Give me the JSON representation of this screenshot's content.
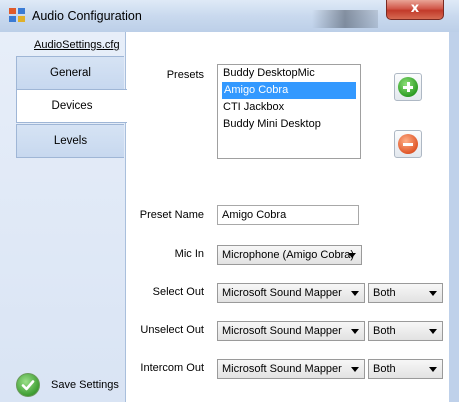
{
  "window": {
    "title": "Audio Configuration",
    "close_glyph": "x"
  },
  "sidebar": {
    "config_link": "AudioSettings.cfg",
    "tabs": [
      {
        "label": "General",
        "active": false
      },
      {
        "label": "Devices",
        "active": true
      },
      {
        "label": "Levels",
        "active": false
      }
    ],
    "save_label": "Save Settings"
  },
  "presets": {
    "label": "Presets",
    "items": [
      "Buddy DesktopMic",
      "Amigo Cobra",
      "CTI Jackbox",
      "Buddy Mini Desktop"
    ],
    "selected": "Amigo Cobra"
  },
  "preset_name": {
    "label": "Preset Name",
    "value": "Amigo Cobra"
  },
  "mic_in": {
    "label": "Mic In",
    "value": "Microphone (Amigo Cobra)"
  },
  "outputs": [
    {
      "label": "Select Out",
      "device": "Microsoft Sound Mapper",
      "channel": "Both"
    },
    {
      "label": "Unselect Out",
      "device": "Microsoft Sound Mapper",
      "channel": "Both"
    },
    {
      "label": "Intercom Out",
      "device": "Microsoft Sound Mapper",
      "channel": "Both"
    }
  ],
  "icons": {
    "app": "audio-config-app-icon",
    "add": "add-circle-icon",
    "remove": "remove-circle-icon",
    "save": "checkmark-circle-icon"
  },
  "colors": {
    "selection": "#3399ff",
    "add": "#2e9e25",
    "remove": "#e0582a"
  }
}
